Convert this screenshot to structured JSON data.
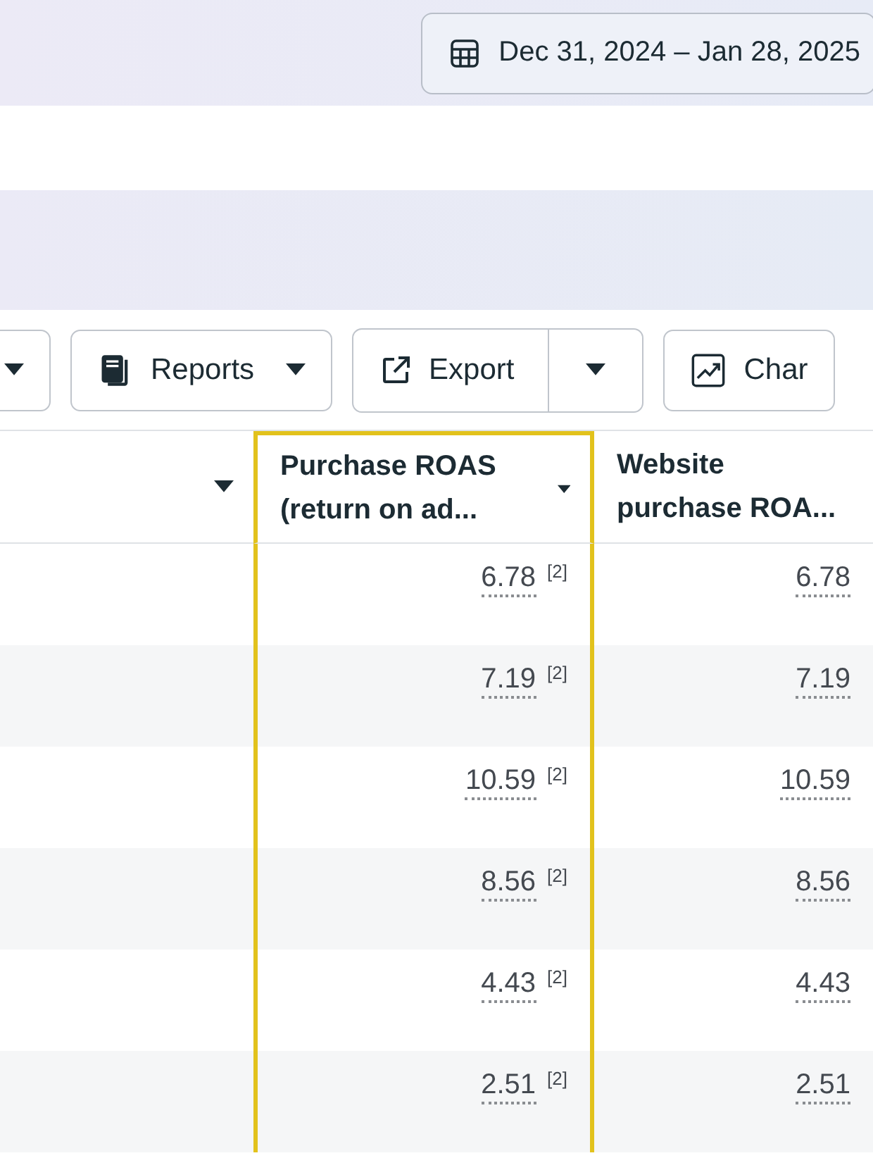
{
  "date_range": {
    "label": "Dec 31, 2024 – Jan 28, 2025"
  },
  "toolbar": [
    {
      "kind": "dropdown"
    },
    {
      "kind": "menu",
      "label": "Reports"
    },
    {
      "kind": "split",
      "label": "Export"
    },
    {
      "kind": "plain",
      "label": "Char"
    }
  ],
  "table": {
    "columns": [
      {
        "label": "Purchase ROAS (return on ad...",
        "selected": true
      },
      {
        "label": "Website purchase ROA...",
        "selected": false
      }
    ],
    "rows": [
      {
        "cells": [
          {
            "value": "6.78",
            "note": "[2]"
          },
          {
            "value": "6.78"
          }
        ]
      },
      {
        "cells": [
          {
            "value": "7.19",
            "note": "[2]"
          },
          {
            "value": "7.19"
          }
        ]
      },
      {
        "cells": [
          {
            "value": "10.59",
            "note": "[2]"
          },
          {
            "value": "10.59"
          }
        ]
      },
      {
        "cells": [
          {
            "value": "8.56",
            "note": "[2]"
          },
          {
            "value": "8.56"
          }
        ]
      },
      {
        "cells": [
          {
            "value": "4.43",
            "note": "[2]"
          },
          {
            "value": "4.43"
          }
        ]
      },
      {
        "cells": [
          {
            "value": "2.51",
            "note": "[2]"
          },
          {
            "value": "2.51"
          }
        ]
      }
    ]
  }
}
